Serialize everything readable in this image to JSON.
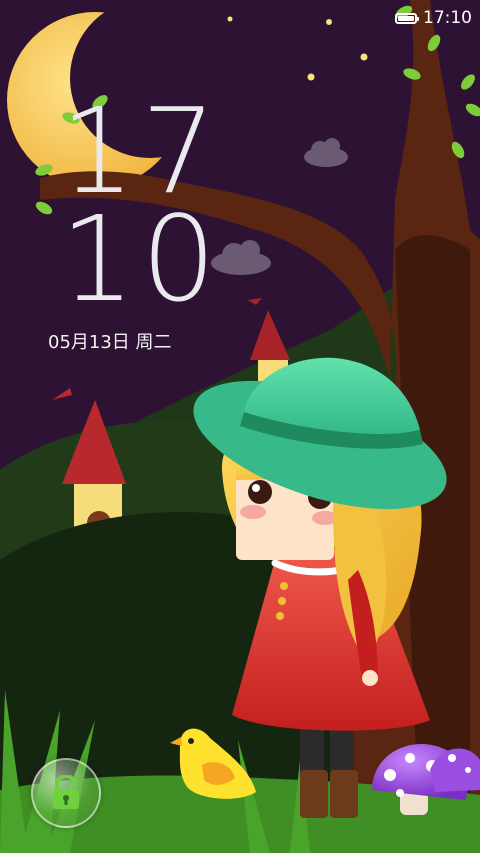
{
  "status_bar": {
    "time": "17:10",
    "battery_icon": "battery-icon"
  },
  "lockscreen": {
    "clock_hour": "17",
    "clock_minute": "10",
    "date": "05月13日 周二",
    "unlock_icon": "unlocked-padlock-icon"
  },
  "colors": {
    "sky": "#2d1232",
    "moon": "#f5c95a",
    "hill_dark": "#1a2a12",
    "grass": "#3f8f24",
    "hat": "#4fd39e",
    "dress": "#d8332b",
    "hair": "#f1c13f"
  }
}
